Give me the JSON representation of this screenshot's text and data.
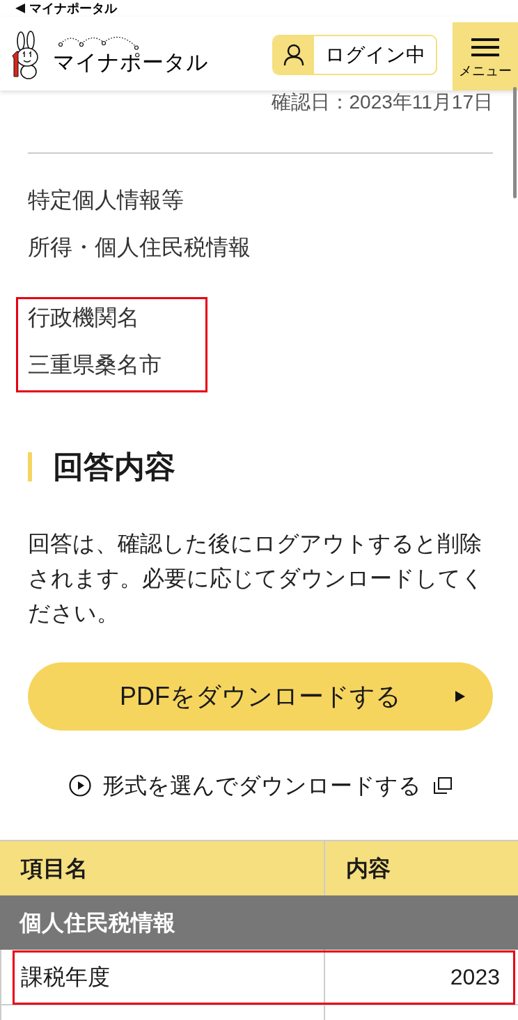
{
  "status_bar": {
    "back_label": "マイナポータル"
  },
  "header": {
    "logo_text": "マイナポータル",
    "login_button": "ログイン中",
    "menu_button": "メニュー"
  },
  "confirmation_date": "確認日：2023年11月17日",
  "info_items": [
    {
      "label": "特定個人情報等",
      "value": "所得・個人住民税情報",
      "highlighted": false
    },
    {
      "label": "行政機関名",
      "value": "三重県桑名市",
      "highlighted": true
    }
  ],
  "answer": {
    "heading": "回答内容",
    "note": "回答は、確認した後にログアウトすると削除されます。必要に応じてダウンロードしてください。",
    "pdf_button": "PDFをダウンロードする",
    "format_link": "形式を選んでダウンロードする"
  },
  "table": {
    "columns": [
      "項目名",
      "内容"
    ],
    "groups": [
      {
        "title": "個人住民税情報",
        "rows": [
          {
            "item": "課税年度",
            "content": "2023",
            "highlighted": true
          }
        ]
      }
    ]
  }
}
